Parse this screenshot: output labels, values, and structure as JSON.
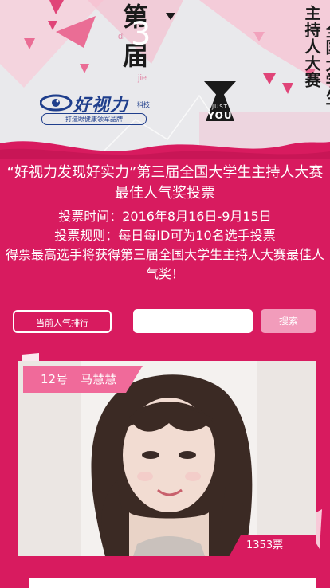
{
  "banner": {
    "number_prefix": "第",
    "number": "3",
    "number_suffix": "届",
    "pinyin_di": "di",
    "pinyin_jie": "jie",
    "title_col1": "主持人大赛",
    "title_col2": "全国大学生",
    "logo_name": "好视力",
    "logo_tag": "科技",
    "logo_slogan": "打造眼健康领军品牌",
    "badge_line1": "JUST",
    "badge_line2": "YOU"
  },
  "intro": {
    "headline": "“好视力发现好实力”第三届全国大学生主持人大赛 最佳人气奖投票",
    "vote_time": "投票时间：2016年8月16日-9月15日",
    "vote_rule": "投票规则：每日每ID可为10名选手投票",
    "prize": "得票最高选手将获得第三届全国大学生主持人大赛最佳人气奖！"
  },
  "controls": {
    "ranking_button": "当前人气排行",
    "search_placeholder": "",
    "search_button": "搜索"
  },
  "candidates": [
    {
      "number": "12号",
      "name": "马慧慧",
      "votes": "1353票"
    }
  ],
  "colors": {
    "primary": "#d81b5f",
    "accent": "#f06a9a",
    "button_light": "#f29cbb"
  }
}
